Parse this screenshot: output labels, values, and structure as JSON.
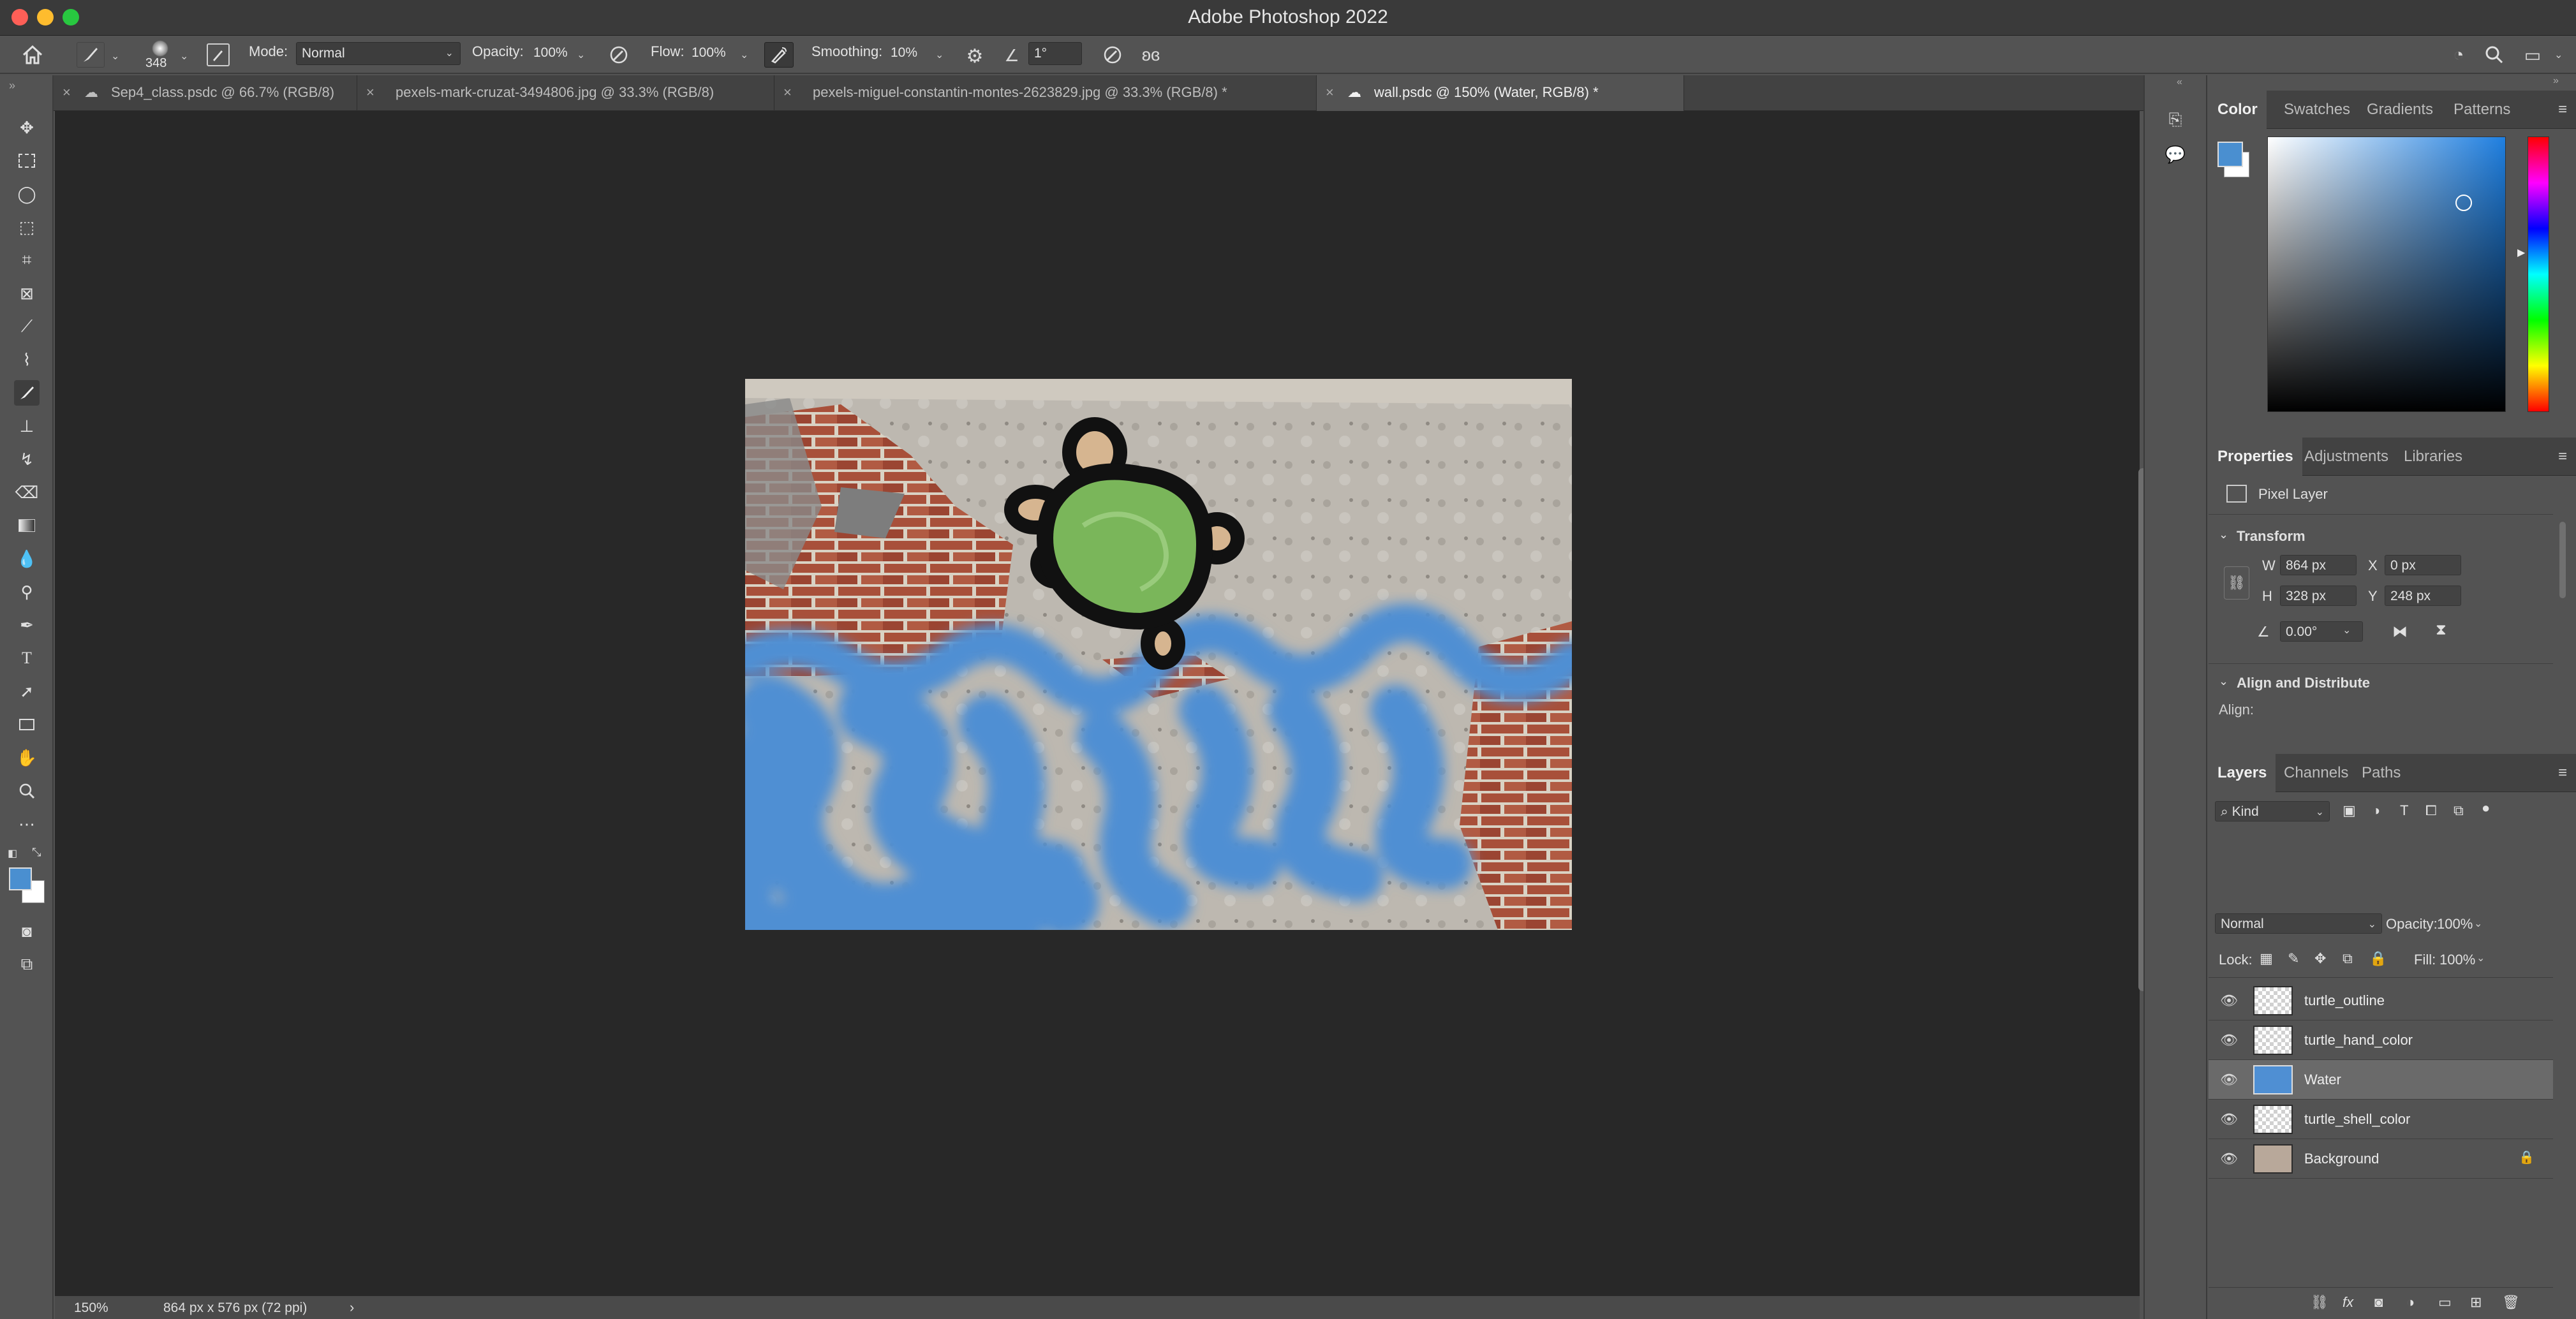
{
  "window": {
    "title": "Adobe Photoshop 2022"
  },
  "options_bar": {
    "brush_size": "348",
    "mode_label": "Mode:",
    "mode_value": "Normal",
    "opacity_label": "Opacity:",
    "opacity_value": "100%",
    "flow_label": "Flow:",
    "flow_value": "100%",
    "smoothing_label": "Smoothing:",
    "smoothing_value": "10%",
    "angle_value": "1°"
  },
  "doc_tabs": [
    {
      "label": "Sep4_class.psdc @ 66.7% (RGB/8)"
    },
    {
      "label": "pexels-mark-cruzat-3494806.jpg @ 33.3% (RGB/8)"
    },
    {
      "label": "pexels-miguel-constantin-montes-2623829.jpg @ 33.3% (RGB/8) *"
    },
    {
      "label": "wall.psdc @ 150% (Water, RGB/8) *"
    }
  ],
  "status": {
    "zoom": "150%",
    "doc_info": "864 px x 576 px (72 ppi)"
  },
  "colors": {
    "foreground": "#4a8fd0",
    "background": "#ffffff",
    "water": "#4f8fd3",
    "shell": "#7ab65a"
  },
  "color_panel": {
    "tabs": [
      "Color",
      "Swatches",
      "Gradients",
      "Patterns"
    ]
  },
  "properties_panel": {
    "tabs": [
      "Properties",
      "Adjustments",
      "Libraries"
    ],
    "layer_type": "Pixel Layer",
    "transform_title": "Transform",
    "w_label": "W",
    "w_value": "864 px",
    "h_label": "H",
    "h_value": "328 px",
    "x_label": "X",
    "x_value": "0 px",
    "y_label": "Y",
    "y_value": "248 px",
    "angle_value": "0.00°",
    "align_title": "Align and Distribute",
    "align_label": "Align:"
  },
  "layers_panel": {
    "tabs": [
      "Layers",
      "Channels",
      "Paths"
    ],
    "filter_kind": "Kind",
    "blend_mode": "Normal",
    "opacity_label": "Opacity:",
    "opacity_value": "100%",
    "lock_label": "Lock:",
    "fill_label": "Fill:",
    "fill_value": "100%",
    "layers": [
      {
        "name": "turtle_outline"
      },
      {
        "name": "turtle_hand_color"
      },
      {
        "name": "Water"
      },
      {
        "name": "turtle_shell_color"
      },
      {
        "name": "Background"
      }
    ]
  }
}
